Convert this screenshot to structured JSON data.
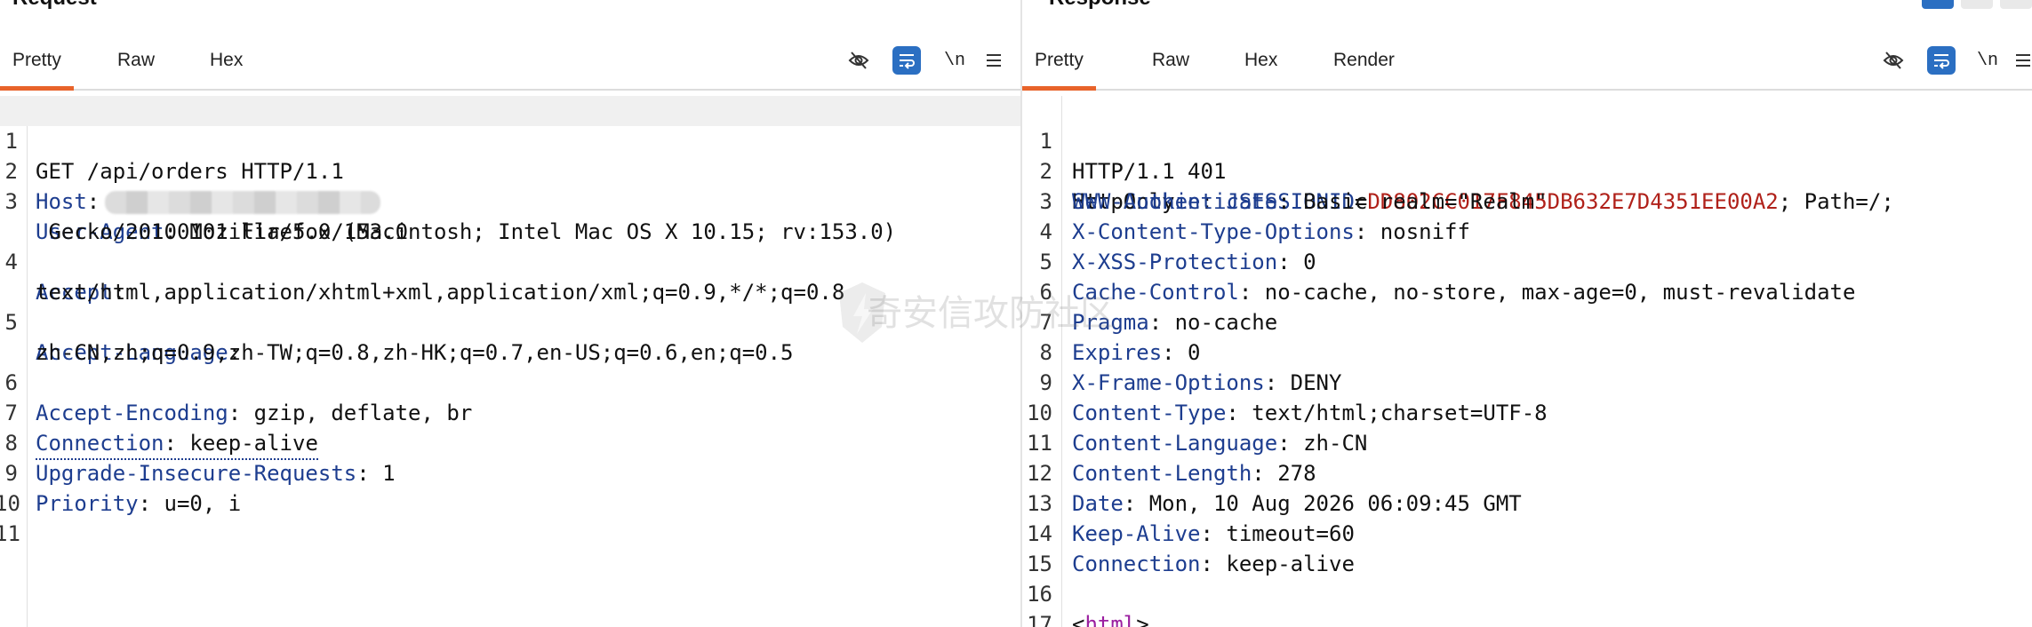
{
  "request": {
    "title": "Request",
    "tabs": [
      "Pretty",
      "Raw",
      "Hex"
    ],
    "active_tab": "Pretty",
    "newline_label": "\\n",
    "lines": [
      {
        "n": "1",
        "key": "GET /api/orders HTTP/1.1",
        "val": ""
      },
      {
        "n": "2",
        "key": "Host",
        "val": ""
      },
      {
        "n": "3",
        "key": "User-Agent",
        "val": " Mozilla/5.0 (Macintosh; Intel Mac OS X 10.15; rv:153.0)"
      },
      {
        "n": "",
        "key": "",
        "val": " Gecko/20100101 Firefox/153.0"
      },
      {
        "n": "4",
        "key": "Accept",
        "val": ""
      },
      {
        "n": "",
        "key": "",
        "val": "text/html,application/xhtml+xml,application/xml;q=0.9,*/*;q=0.8"
      },
      {
        "n": "5",
        "key": "Accept-Language",
        "val": ""
      },
      {
        "n": "",
        "key": "",
        "val": "zh-CN,zh;q=0.9,zh-TW;q=0.8,zh-HK;q=0.7,en-US;q=0.6,en;q=0.5"
      },
      {
        "n": "6",
        "key": "Accept-Encoding",
        "val": " gzip, deflate, br"
      },
      {
        "n": "7",
        "key": "Connection",
        "val": " keep-alive"
      },
      {
        "n": "8",
        "key": "Upgrade-Insecure-Requests",
        "val": " 1"
      },
      {
        "n": "9",
        "key": "Priority",
        "val": " u=0, i"
      },
      {
        "n": "10",
        "key": "",
        "val": ""
      },
      {
        "n": "11",
        "key": "",
        "val": ""
      }
    ]
  },
  "response": {
    "title": "Response",
    "tabs": [
      "Pretty",
      "Raw",
      "Hex",
      "Render"
    ],
    "active_tab": "Pretty",
    "newline_label": "\\n",
    "status_line": "HTTP/1.1 401",
    "cookie": {
      "key": "Set-Cookie",
      "name": "JSESSIONID",
      "value": "DD802CC017F845DB632E7D4351EE00A2",
      "rest": "; Path=/;",
      "cont": "HttpOnly"
    },
    "headers": [
      {
        "n": "3",
        "key": "WWW-Authenticate",
        "val": " Basic realm=\"Realm\""
      },
      {
        "n": "4",
        "key": "X-Content-Type-Options",
        "val": " nosniff"
      },
      {
        "n": "5",
        "key": "X-XSS-Protection",
        "val": " 0"
      },
      {
        "n": "6",
        "key": "Cache-Control",
        "val": " no-cache, no-store, max-age=0, must-revalidate"
      },
      {
        "n": "7",
        "key": "Pragma",
        "val": " no-cache"
      },
      {
        "n": "8",
        "key": "Expires",
        "val": " 0"
      },
      {
        "n": "9",
        "key": "X-Frame-Options",
        "val": " DENY"
      },
      {
        "n": "10",
        "key": "Content-Type",
        "val": " text/html;charset=UTF-8"
      },
      {
        "n": "11",
        "key": "Content-Language",
        "val": " zh-CN"
      },
      {
        "n": "12",
        "key": "Content-Length",
        "val": " 278"
      },
      {
        "n": "13",
        "key": "Date",
        "val": " Mon, 10 Aug 2026 06:09:45 GMT"
      },
      {
        "n": "14",
        "key": "Keep-Alive",
        "val": " timeout=60"
      },
      {
        "n": "15",
        "key": "Connection",
        "val": " keep-alive"
      }
    ],
    "blank_line_n": "16",
    "html_line": {
      "n": "17",
      "open": "<",
      "tag": "html",
      "close": ">"
    }
  },
  "watermark": "奇安信攻防社区",
  "colors": {
    "accent_tab": "#e8632a",
    "header_key": "#1d3d8f",
    "cookie_value": "#b0211a",
    "toggle_bg": "#2b6fc2"
  },
  "icons": [
    "eye-slash-icon",
    "wrap-icon",
    "menu-icon"
  ]
}
